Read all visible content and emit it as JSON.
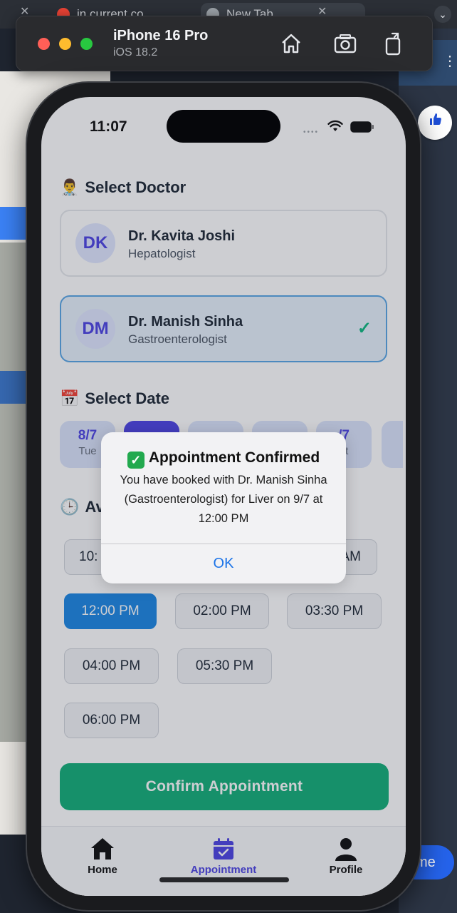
{
  "browser": {
    "tabs": [
      {
        "label": "in current co",
        "favicon_color": "#ea4335"
      },
      {
        "label": "New Tab",
        "favicon_color": "#9aa0a6"
      }
    ],
    "side_button_label": "me"
  },
  "simulator": {
    "device": "iPhone 16 Pro",
    "os": "iOS 18.2",
    "icons": [
      "home-icon",
      "screenshot-icon",
      "rotate-icon"
    ]
  },
  "status_bar": {
    "time": "11:07"
  },
  "doctor_section": {
    "emoji": "👨‍⚕️",
    "title": "Select Doctor",
    "doctors": [
      {
        "initials": "DK",
        "name": "Dr. Kavita Joshi",
        "specialty": "Hepatologist",
        "selected": false
      },
      {
        "initials": "DM",
        "name": "Dr. Manish Sinha",
        "specialty": "Gastroenterologist",
        "selected": true
      }
    ],
    "check": "✓"
  },
  "date_section": {
    "emoji": "📅",
    "title": "Select Date",
    "dates": [
      {
        "date": "8/7",
        "weekday": "Tue"
      },
      {
        "date": "",
        "weekday": ""
      },
      {
        "date": "",
        "weekday": ""
      },
      {
        "date": "",
        "weekday": ""
      },
      {
        "date": "/7",
        "weekday": "at"
      }
    ]
  },
  "time_section": {
    "emoji": "🕒",
    "title_partial": "Av",
    "slots": [
      "10:",
      "AM",
      "12:00 PM",
      "02:00 PM",
      "03:30 PM",
      "04:00 PM",
      "05:30 PM",
      "06:00 PM"
    ],
    "selected": "12:00 PM"
  },
  "confirm_button": "Confirm Appointment",
  "tab_bar": {
    "items": [
      {
        "label": "Home",
        "icon": "home-icon",
        "active": false
      },
      {
        "label": "Appointment",
        "icon": "calendar-check-icon",
        "active": true
      },
      {
        "label": "Profile",
        "icon": "person-icon",
        "active": false
      }
    ],
    "active_color": "#4f46e5"
  },
  "alert": {
    "emoji": "✓",
    "title": "Appointment Confirmed",
    "message": "You have booked with Dr. Manish Sinha (Gastroenterologist) for Liver on 9/7 at 12:00 PM",
    "button": "OK"
  },
  "colors": {
    "primary": "#4f46e5",
    "confirm": "#15b07a",
    "selected_time": "#1e88e5",
    "alert_button": "#1a73e8"
  }
}
